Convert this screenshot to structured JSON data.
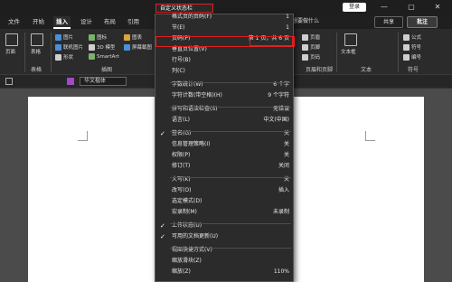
{
  "titlebar": {
    "menu_title": "自定义状态栏",
    "login_label": "登录",
    "minimize": "—",
    "restore": "▢",
    "close": "✕"
  },
  "tabs": [
    "文件",
    "开始",
    "插入",
    "设计",
    "布局",
    "引用"
  ],
  "tab_partial": "告诉我你想要做什么",
  "share_label": "共享",
  "comment_label": "批注",
  "ribbon": {
    "pages_label": "页面",
    "table_label": "表格",
    "table_group": "表格",
    "illustration_group": "插图",
    "illus": [
      "图片",
      "图标",
      "图表",
      "联机图片",
      "3D 模型",
      "屏幕截图",
      "形状",
      "SmartArt"
    ],
    "header_footer": [
      "页眉",
      "页脚",
      "页码"
    ],
    "header_footer_group": "页眉和页脚",
    "textbox_label": "文本框",
    "text_group": "文本",
    "symbols": [
      "公式",
      "符号",
      "编号"
    ],
    "symbol_group": "符号"
  },
  "qat": {
    "font": "华文楷体"
  },
  "menu": {
    "items": [
      {
        "label": "格式页的页码(F)",
        "value": "1",
        "checked": false
      },
      {
        "label": "节(E)",
        "value": "1",
        "checked": false
      },
      {
        "label": "页码(P)",
        "value": "第 1 页，共 6 页",
        "checked": false,
        "highlight": true
      },
      {
        "label": "垂直页位置(V)",
        "value": "",
        "checked": false
      },
      {
        "label": "行号(B)",
        "value": "",
        "checked": false
      },
      {
        "label": "列(C)",
        "value": "",
        "checked": false
      },
      {
        "label": "字数统计(W)",
        "value": "6 个字",
        "checked": false
      },
      {
        "label": "字符计数(带空格)(H)",
        "value": "9 个字符",
        "checked": false
      },
      {
        "label": "拼写和语法检查(S)",
        "value": "无错误",
        "checked": false
      },
      {
        "label": "语言(L)",
        "value": "中文(中国)",
        "checked": false
      },
      {
        "label": "签名(G)",
        "value": "关",
        "checked": true
      },
      {
        "label": "信息管理策略(I)",
        "value": "关",
        "checked": false
      },
      {
        "label": "权限(P)",
        "value": "关",
        "checked": false
      },
      {
        "label": "修订(T)",
        "value": "关闭",
        "checked": false
      },
      {
        "label": "大写(K)",
        "value": "关",
        "checked": false
      },
      {
        "label": "改写(O)",
        "value": "插入",
        "checked": false
      },
      {
        "label": "选定模式(D)",
        "value": "",
        "checked": false
      },
      {
        "label": "宏录制(M)",
        "value": "未录制",
        "checked": false
      },
      {
        "label": "上传状态(U)",
        "value": "",
        "checked": true
      },
      {
        "label": "可用的文档更新(U)",
        "value": "",
        "checked": true
      },
      {
        "label": "视图快捷方式(V)",
        "value": "",
        "checked": false
      },
      {
        "label": "缩放滑块(Z)",
        "value": "",
        "checked": false
      },
      {
        "label": "缩放(Z)",
        "value": "110%",
        "checked": false
      }
    ]
  }
}
